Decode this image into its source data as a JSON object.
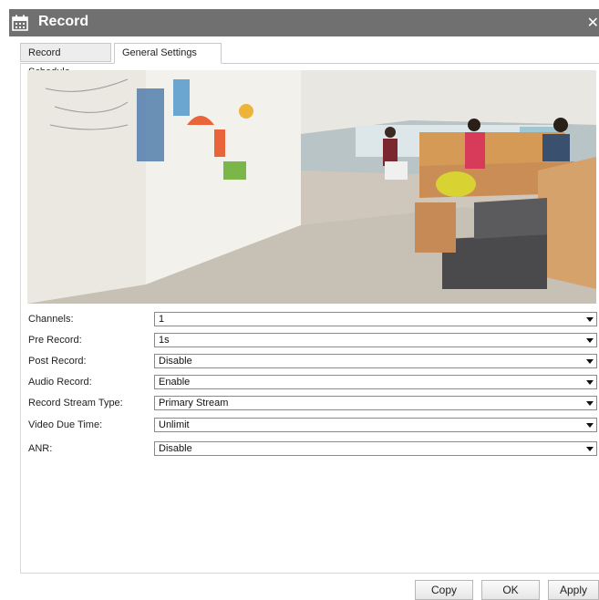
{
  "window": {
    "title": "Record",
    "calendar_icon": "calendar-icon",
    "close_icon": "close-icon"
  },
  "tabs": [
    {
      "label": "Record Schedule",
      "active": false
    },
    {
      "label": "General Settings",
      "active": true
    }
  ],
  "preview": {
    "type": "camera-snapshot",
    "scene": "office-interior"
  },
  "settings": {
    "channels": {
      "label": "Channels:",
      "value": "1"
    },
    "pre_record": {
      "label": "Pre Record:",
      "value": "1s"
    },
    "post_record": {
      "label": "Post Record:",
      "value": "Disable"
    },
    "audio_record": {
      "label": "Audio Record:",
      "value": "Enable"
    },
    "record_stream_type": {
      "label": "Record Stream Type:",
      "value": "Primary Stream"
    },
    "video_due_time": {
      "label": "Video Due Time:",
      "value": "Unlimit"
    },
    "anr": {
      "label": "ANR:",
      "value": "Disable"
    }
  },
  "buttons": {
    "copy": "Copy",
    "ok": "OK",
    "apply": "Apply"
  }
}
